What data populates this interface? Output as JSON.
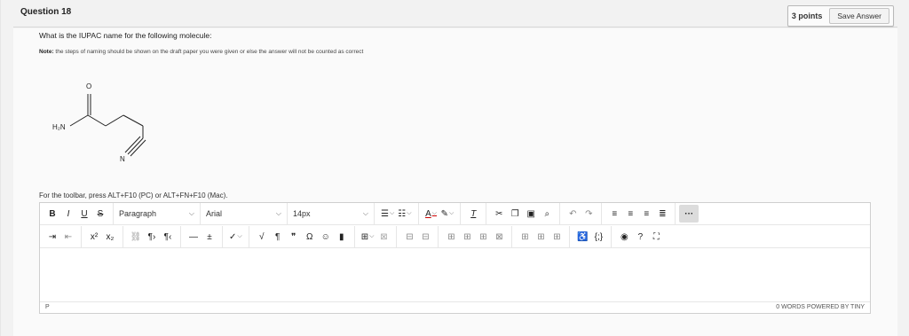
{
  "question": {
    "title": "Question 18",
    "points": "3 points",
    "save_label": "Save Answer",
    "prompt": "What is the IUPAC name for the following molecule:",
    "note_label": "Note:",
    "note_text": " the steps of naming should be shown on the draft paper you were given or else the answer will not be counted as correct"
  },
  "molecule": {
    "atom_o": "O",
    "atom_h2n": "H₂N",
    "atom_n": "N"
  },
  "editor": {
    "hint": "For the toolbar, press ALT+F10 (PC) or ALT+FN+F10 (Mac).",
    "format_select": "Paragraph",
    "font_select": "Arial",
    "size_select": "14px",
    "status_path": "P",
    "word_count": "0 WORDS",
    "powered_by": "POWERED BY TINY"
  },
  "toolbar_icons_row1": [
    "bold-icon",
    "italic-icon",
    "underline-icon",
    "strikethrough-icon",
    "bullet-list-icon",
    "numbered-list-icon",
    "text-color-icon",
    "highlight-icon",
    "clear-format-icon",
    "cut-icon",
    "copy-icon",
    "paste-icon",
    "find-icon",
    "undo-icon",
    "redo-icon",
    "align-left-icon",
    "align-center-icon",
    "align-right-icon",
    "justify-icon",
    "more-icon"
  ],
  "toolbar_icons_row2": [
    "indent-icon",
    "outdent-icon",
    "superscript-icon",
    "subscript-icon",
    "unlink-icon",
    "ltr-icon",
    "rtl-icon",
    "horizontal-line-icon",
    "insert-icon",
    "spellcheck-icon",
    "math-icon",
    "paragraph-icon",
    "quote-icon",
    "omega-icon",
    "emoji-icon",
    "bookmark-icon",
    "table-icon",
    "table-delete-icon",
    "table-row-icon",
    "table-col-icon",
    "table-cell-icon",
    "code-icon",
    "accessibility-icon",
    "source-icon",
    "preview-icon",
    "help-icon",
    "fullscreen-icon"
  ]
}
